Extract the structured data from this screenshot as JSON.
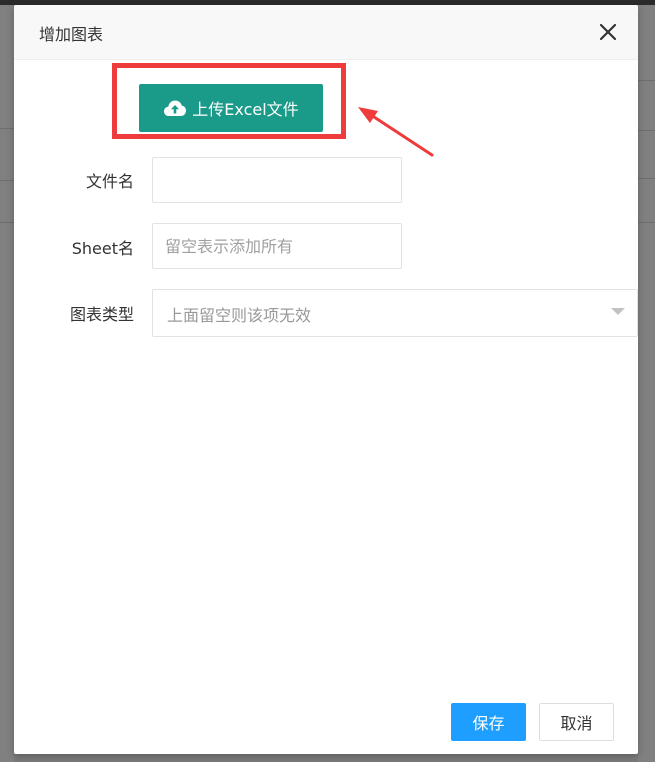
{
  "dialog": {
    "title": "增加图表",
    "close_icon": "close-icon"
  },
  "upload": {
    "label": "上传Excel文件",
    "icon": "cloud-upload-icon",
    "button_color": "#1a9a88"
  },
  "annotation": {
    "box_color": "#ee3b3b",
    "arrow_color": "#ee3b3b"
  },
  "form": {
    "filename": {
      "label": "文件名",
      "value": "",
      "placeholder": ""
    },
    "sheet": {
      "label": "Sheet名",
      "value": "",
      "placeholder": "留空表示添加所有"
    },
    "chart_type": {
      "label": "图表类型",
      "placeholder": "上面留空则该项无效",
      "caret_icon": "caret-down-icon"
    }
  },
  "footer": {
    "save_label": "保存",
    "cancel_label": "取消",
    "primary_color": "#1e9fff"
  }
}
